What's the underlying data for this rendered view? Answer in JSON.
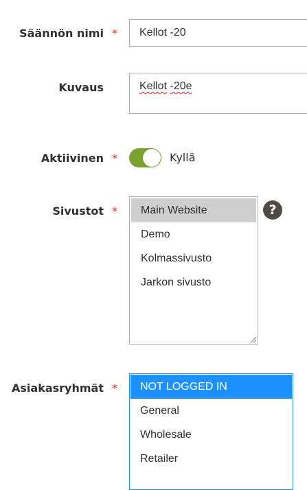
{
  "form": {
    "rule_name": {
      "label": "Säännön nimi",
      "required_mark": "*",
      "value": "Kellot -20"
    },
    "description": {
      "label": "Kuvaus",
      "value": "Kellot -20e",
      "value_part1": "Kellot",
      "value_part2": " ",
      "value_part3": "-20e"
    },
    "active": {
      "label": "Aktiivinen",
      "required_mark": "*",
      "toggle_on": true,
      "toggle_text": "Kyllä",
      "toggle_color": "#79a22e"
    },
    "websites": {
      "label": "Sivustot",
      "required_mark": "*",
      "options": [
        "Main Website",
        "Demo",
        "Kolmassivusto",
        "Jarkon sivusto"
      ],
      "selected": "Main Website",
      "help_icon": "question-circle-icon",
      "help_glyph": "?"
    },
    "customer_groups": {
      "label": "Asiakasryhmät",
      "required_mark": "*",
      "options": [
        "NOT LOGGED IN",
        "General",
        "Wholesale",
        "Retailer"
      ],
      "selected": "NOT LOGGED IN",
      "selected_color": "#1e90ff"
    }
  },
  "colors": {
    "required": "#e22626",
    "text": "#303030",
    "border": "#adadad"
  }
}
